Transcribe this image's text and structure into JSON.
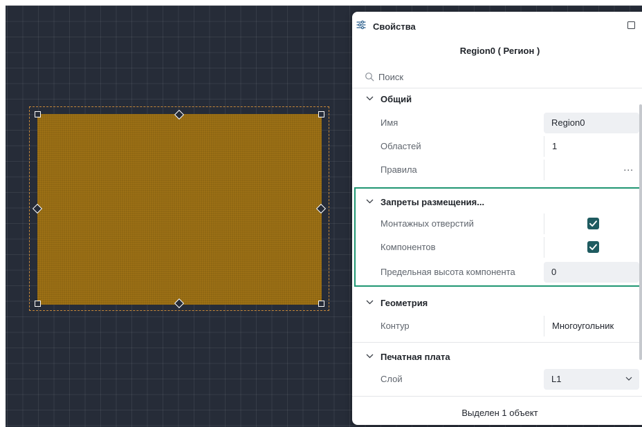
{
  "panel": {
    "title": "Свойства",
    "icon": "sliders-icon",
    "object_title": "Region0 ( Регион )",
    "search": {
      "placeholder": "Поиск",
      "value": ""
    },
    "sections": {
      "general": {
        "label": "Общий",
        "expanded": true,
        "rows": {
          "name": {
            "label": "Имя",
            "value": "Region0"
          },
          "areas": {
            "label": "Областей",
            "value": "1"
          },
          "rules": {
            "label": "Правила",
            "value": "..."
          }
        }
      },
      "placement": {
        "label": "Запреты размещения...",
        "expanded": true,
        "highlighted": true,
        "rows": {
          "mounting_holes": {
            "label": "Монтажных отверстий",
            "checked": true
          },
          "components": {
            "label": "Компонентов",
            "checked": true
          },
          "max_height": {
            "label": "Предельная высота компонента",
            "value": "0"
          }
        }
      },
      "geometry": {
        "label": "Геометрия",
        "expanded": true,
        "rows": {
          "contour": {
            "label": "Контур",
            "value": "Многоугольник"
          }
        }
      },
      "pcb": {
        "label": "Печатная плата",
        "expanded": true,
        "rows": {
          "layer": {
            "label": "Слой",
            "value": "L1"
          }
        }
      }
    },
    "footer": "Выделен 1 объект"
  },
  "colors": {
    "canvas_bg": "#262c38",
    "region_fill": "#8f6713",
    "selection_frame": "#c8893a",
    "checkbox": "#1f5b60",
    "highlight_border": "#1f9672"
  }
}
